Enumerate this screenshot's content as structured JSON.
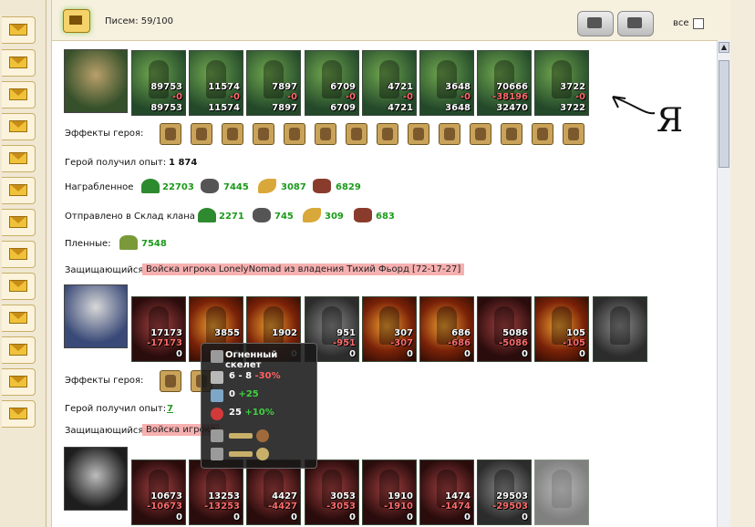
{
  "header": {
    "letters_label": "Писем: 59/100",
    "all_label": "все"
  },
  "battle1": {
    "attacker_units": [
      {
        "top": "89753",
        "mid": "-0",
        "bot": "89753"
      },
      {
        "top": "11574",
        "mid": "-0",
        "bot": "11574"
      },
      {
        "top": "7897",
        "mid": "-0",
        "bot": "7897"
      },
      {
        "top": "6709",
        "mid": "-0",
        "bot": "6709"
      },
      {
        "top": "4721",
        "mid": "-0",
        "bot": "4721"
      },
      {
        "top": "3648",
        "mid": "-0",
        "bot": "3648"
      },
      {
        "top": "70666",
        "mid": "-38196",
        "bot": "32470"
      },
      {
        "top": "3722",
        "mid": "-0",
        "bot": "3722"
      }
    ],
    "effects_label": "Эффекты героя:",
    "exp_label": "Герой получил опыт:",
    "exp_value": "1 874",
    "loot_label": "Награбленное",
    "loot": [
      "22703",
      "7445",
      "3087",
      "6829"
    ],
    "clan_label": "Отправлено в Склад клана",
    "clan": [
      "2271",
      "745",
      "309",
      "683"
    ],
    "prisoners_label": "Пленные:",
    "prisoners": "7548",
    "defender_label": "Защищающийся",
    "defender_text": "Войска игрока LonelyNomad из владения Тихий Фьорд [72-17-27]"
  },
  "battle2": {
    "defender_units": [
      {
        "top": "17173",
        "mid": "-17173",
        "bot": "0"
      },
      {
        "top": "3855",
        "mid": "",
        "bot": "0"
      },
      {
        "top": "1902",
        "mid": "",
        "bot": "0"
      },
      {
        "top": "951",
        "mid": "-951",
        "bot": "0"
      },
      {
        "top": "307",
        "mid": "-307",
        "bot": "0"
      },
      {
        "top": "686",
        "mid": "-686",
        "bot": "0"
      },
      {
        "top": "5086",
        "mid": "-5086",
        "bot": "0"
      },
      {
        "top": "105",
        "mid": "-105",
        "bot": "0"
      },
      {
        "top": "",
        "mid": "",
        "bot": ""
      }
    ],
    "effects_label": "Эффекты героя:",
    "exp_label": "Герой получил опыт:",
    "exp_value": "7",
    "defender_label": "Защищающийся",
    "defender_text": "Войска игрока"
  },
  "battle3": {
    "units": [
      {
        "top": "10673",
        "mid": "-10673",
        "bot": "0"
      },
      {
        "top": "13253",
        "mid": "-13253",
        "bot": "0"
      },
      {
        "top": "4427",
        "mid": "-4427",
        "bot": "0"
      },
      {
        "top": "3053",
        "mid": "-3053",
        "bot": "0"
      },
      {
        "top": "1910",
        "mid": "-1910",
        "bot": "0"
      },
      {
        "top": "1474",
        "mid": "-1474",
        "bot": "0"
      },
      {
        "top": "29503",
        "mid": "-29503",
        "bot": "0"
      },
      {
        "top": "",
        "mid": "",
        "bot": ""
      }
    ]
  },
  "tooltip": {
    "title": "Огненный скелет",
    "attack": "6 - 8",
    "attack_mod": "-30%",
    "defense": "0",
    "defense_mod": "+25",
    "hp": "25",
    "hp_mod": "+10%"
  },
  "annotation": {
    "letter": "Я"
  },
  "colors": {
    "accent_green": "#1a9a1a",
    "loss_red": "#ff6b6b",
    "pink_bg": "#f7b0b0"
  }
}
